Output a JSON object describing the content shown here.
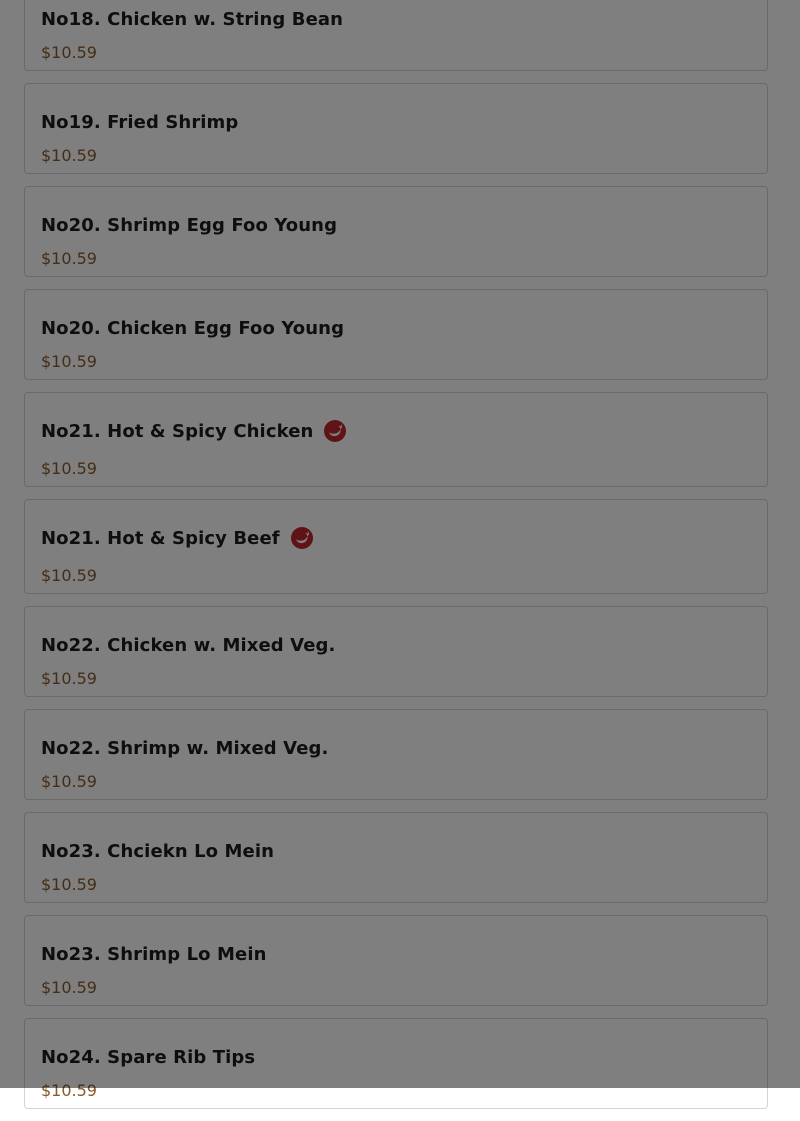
{
  "menu": {
    "items": [
      {
        "name": "No18. Chicken w. String Bean",
        "price": "$10.59",
        "spicy": false
      },
      {
        "name": "No19. Fried Shrimp",
        "price": "$10.59",
        "spicy": false
      },
      {
        "name": "No20. Shrimp Egg Foo Young",
        "price": "$10.59",
        "spicy": false
      },
      {
        "name": "No20. Chicken Egg Foo Young",
        "price": "$10.59",
        "spicy": false
      },
      {
        "name": "No21. Hot & Spicy Chicken",
        "price": "$10.59",
        "spicy": true
      },
      {
        "name": "No21. Hot & Spicy Beef",
        "price": "$10.59",
        "spicy": true
      },
      {
        "name": "No22. Chicken w. Mixed Veg.",
        "price": "$10.59",
        "spicy": false
      },
      {
        "name": "No22. Shrimp w. Mixed Veg.",
        "price": "$10.59",
        "spicy": false
      },
      {
        "name": "No23. Chciekn Lo Mein",
        "price": "$10.59",
        "spicy": false
      },
      {
        "name": "No23. Shrimp Lo Mein",
        "price": "$10.59",
        "spicy": false
      },
      {
        "name": "No24. Spare Rib Tips",
        "price": "$10.59",
        "spicy": false
      }
    ],
    "spicy_icon": "chili-pepper-icon"
  },
  "colors": {
    "price": "#8a5a2c",
    "spicy_icon": "#c0262e",
    "overlay": "rgba(0,0,0,0.5)"
  }
}
